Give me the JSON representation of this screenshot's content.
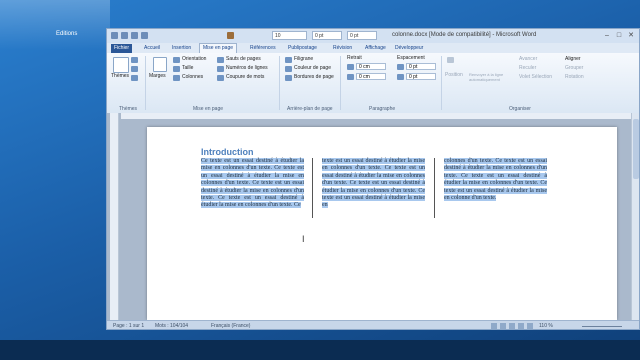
{
  "desktop": {
    "icon_label": "Editions"
  },
  "window": {
    "title": "colonne.docx [Mode de compatibilité] - Microsoft Word",
    "font_size": "10",
    "spacing_before": "0 pt",
    "spacing_after": "0 pt"
  },
  "tabs": [
    "Fichier",
    "Accueil",
    "Insertion",
    "Mise en page",
    "Références",
    "Publipostage",
    "Révision",
    "Affichage",
    "Développeur"
  ],
  "ribbon": {
    "themes": {
      "button": "Thèmes",
      "group": "Thèmes"
    },
    "page_setup": {
      "margins": "Marges",
      "orientation": "Orientation",
      "size": "Taille",
      "columns": "Colonnes",
      "breaks": "Sauts de pages",
      "line_numbers": "Numéros de lignes",
      "hyphenation": "Coupure de mots",
      "group": "Mise en page"
    },
    "background": {
      "watermark": "Filigrane",
      "page_color": "Couleur de page",
      "page_borders": "Bordures de page",
      "group": "Arrière-plan de page"
    },
    "paragraph": {
      "indent_label": "Retrait",
      "indent_left": "0 cm",
      "indent_right": "0 cm",
      "spacing_label": "Espacement",
      "spacing_before": "0 pt",
      "spacing_after": "0 pt",
      "group": "Paragraphe"
    },
    "arrange": {
      "position": "Position",
      "wrap": "Renvoyer à la ligne automatiquement",
      "forward": "Avancer",
      "backward": "Reculer",
      "selection": "Volet Sélection",
      "align": "Aligner",
      "group_btn": "Grouper",
      "rotate": "Rotation",
      "group": "Organiser"
    }
  },
  "document": {
    "heading": "Introduction",
    "col1": "Ce texte est un essai destiné à étudier la mise en colonnes d'un texte. Ce texte est un essai destiné à étudier la mise en colonnes d'un texte. Ce texte est un essai destiné à étudier la mise en colonnes d'un texte. Ce texte est un essai destiné à étudier la mise en colonnes d'un texte. Ce",
    "col2": "texte est un essai destiné à étudier la mise en colonnes d'un texte. Ce texte est un essai destiné à étudier la mise en colonnes d'un texte. Ce texte est un essai destiné à étudier la mise en colonnes d'un texte. Ce texte est un essai destiné à étudier la mise en",
    "col3": "colonnes d'un texte. Ce texte est un essai destiné à étudier la mise en colonnes d'un texte. Ce texte est un essai destiné à étudier la mise en colonnes d'un texte. Ce texte est un essai destiné à étudier la mise en colonne d'un texte."
  },
  "status": {
    "page": "Page : 1 sur 1",
    "words": "Mots : 104/104",
    "language": "Français (France)",
    "zoom": "110 %"
  }
}
